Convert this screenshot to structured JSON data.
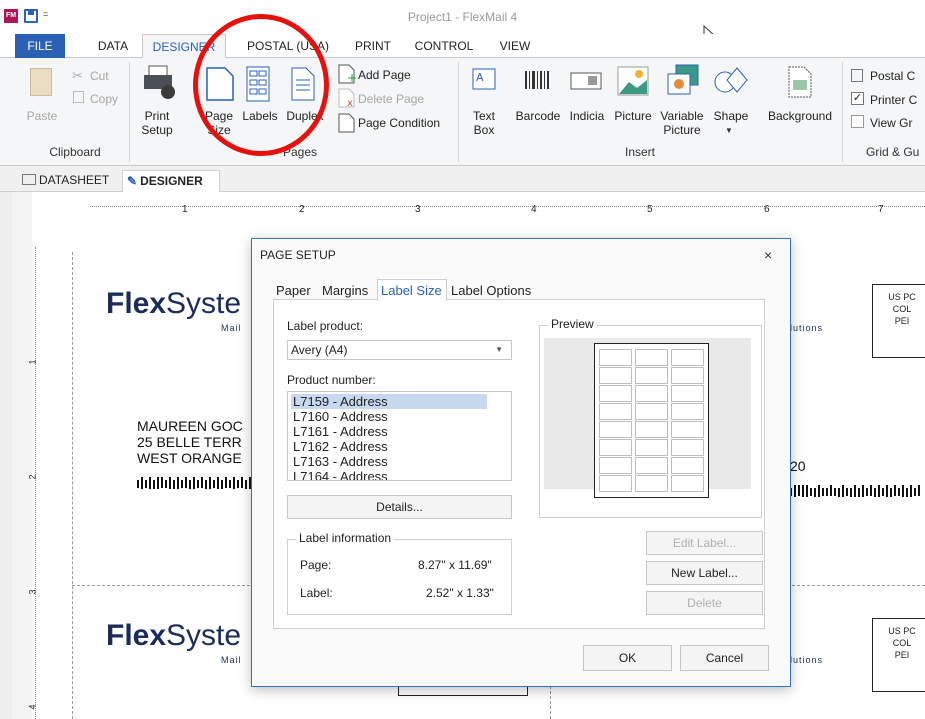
{
  "window": {
    "title": "Project1 - FlexMail 4",
    "app_icon_text": "FM",
    "qat_dropdown": "="
  },
  "menu": {
    "tabs": [
      "FILE",
      "DATA",
      "DESIGNER",
      "POSTAL (USA)",
      "PRINT",
      "CONTROL",
      "VIEW"
    ]
  },
  "ribbon": {
    "clipboard": {
      "paste": "Paste",
      "cut": "Cut",
      "copy": "Copy",
      "group": "Clipboard"
    },
    "pages": {
      "print_setup_1": "Print",
      "print_setup_2": "Setup",
      "page_size_1": "Page",
      "page_size_2": "Size",
      "labels": "Labels",
      "duplex": "Duplex",
      "add_page": "Add Page",
      "delete_page": "Delete Page",
      "page_condition": "Page Condition",
      "group": "Pages"
    },
    "insert": {
      "text_box_1": "Text",
      "text_box_2": "Box",
      "barcode": "Barcode",
      "indicia": "Indicia",
      "picture": "Picture",
      "variable_picture_1": "Variable",
      "variable_picture_2": "Picture",
      "shape": "Shape",
      "background": "Background",
      "group": "Insert"
    },
    "grid": {
      "postal": "Postal C",
      "printer": "Printer C",
      "view_grid": "View Gr",
      "group": "Grid & Gu"
    }
  },
  "doc_tabs": {
    "datasheet": "DATASHEET",
    "designer": "DESIGNER"
  },
  "canvas": {
    "ruler_h": [
      "1",
      "2",
      "3",
      "4",
      "5",
      "6",
      "7"
    ],
    "ruler_v": [
      "1",
      "2",
      "3",
      "4"
    ],
    "logo_bold": "Flex",
    "logo_light": "Syste",
    "logo_tagline": "Mail",
    "logo_tagline_right": "lutions",
    "address_line1": "MAUREEN GOC",
    "address_line2": "25 BELLE TERR",
    "address_line3": "WEST ORANGE",
    "zip_fragment": "20",
    "permit_lines": [
      "US PC",
      "COL",
      "PEI"
    ]
  },
  "dialog": {
    "title": "PAGE SETUP",
    "close": "×",
    "tabs": [
      "Paper",
      "Margins",
      "Label Size",
      "Label Options"
    ],
    "label_product_label": "Label product:",
    "label_product_value": "Avery (A4)",
    "product_number_label": "Product number:",
    "product_numbers": [
      "L7159 - Address",
      "L7160 - Address",
      "L7161 - Address",
      "L7162 - Address",
      "L7163 - Address",
      "L7164 - Address"
    ],
    "details_button": "Details...",
    "preview_legend": "Preview",
    "label_info_legend": "Label information",
    "page_label": "Page:",
    "page_value": "8.27\" x 11.69\"",
    "label_label": "Label:",
    "label_value": "2.52\" x 1.33\"",
    "edit_label_button": "Edit Label...",
    "new_label_button": "New Label...",
    "delete_button": "Delete",
    "ok_button": "OK",
    "cancel_button": "Cancel"
  },
  "colors": {
    "accent": "#2b61b5",
    "highlight_circle": "#e5110c"
  }
}
